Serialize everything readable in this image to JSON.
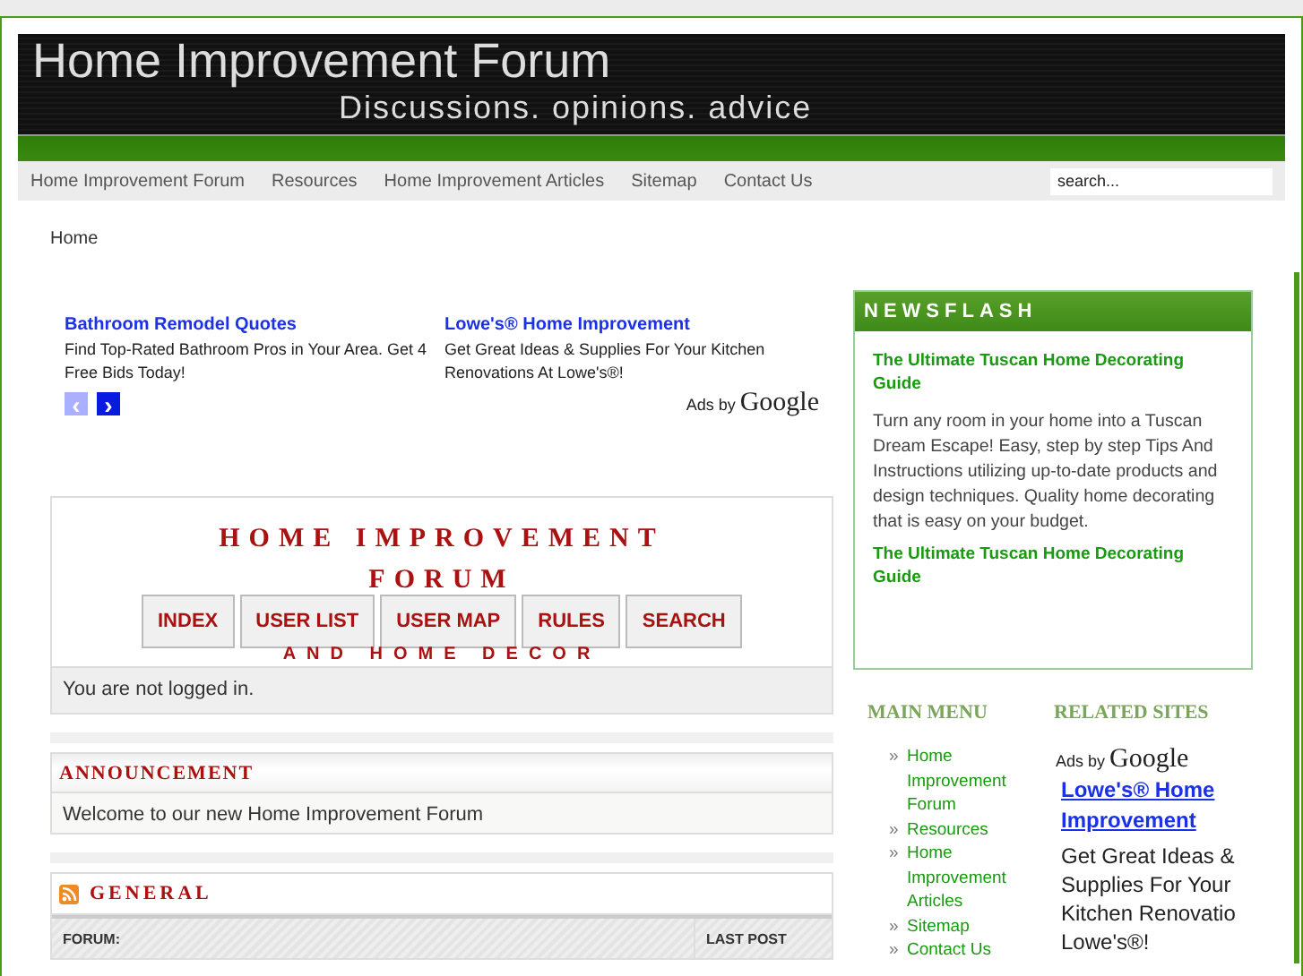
{
  "header": {
    "title": "Home Improvement Forum",
    "tagline": "Discussions. opinions. advice"
  },
  "nav": {
    "items": [
      {
        "label": "Home Improvement Forum"
      },
      {
        "label": "Resources"
      },
      {
        "label": "Home Improvement Articles"
      },
      {
        "label": "Sitemap"
      },
      {
        "label": "Contact Us"
      }
    ],
    "search": {
      "placeholder": "search..."
    }
  },
  "breadcrumb": "Home",
  "ads": {
    "items": [
      {
        "title": "Bathroom Remodel Quotes",
        "text": "Find Top-Rated Bathroom Pros in Your Area. Get 4 Free Bids Today!"
      },
      {
        "title": "Lowe's® Home Improvement",
        "text": "Get Great Ideas & Supplies For Your Kitchen Renovations At Lowe's®!"
      }
    ],
    "pager": [
      {
        "glyph": "‹",
        "disabled": true
      },
      {
        "glyph": "›",
        "disabled": false
      }
    ],
    "ads_by": "Ads by",
    "brand": "Google"
  },
  "forum": {
    "title_lines": [
      "HOME IMPROVEMENT",
      "FORUM"
    ],
    "subtitle": "AND HOME DECOR",
    "buttons": [
      "INDEX",
      "USER LIST",
      "USER MAP",
      "RULES",
      "SEARCH"
    ],
    "status": "You are not logged in."
  },
  "announcement": {
    "title": "ANNOUNCEMENT",
    "text": "Welcome to our new Home Improvement Forum"
  },
  "general": {
    "title": "GENERAL",
    "columns": [
      "FORUM:",
      "LAST POST"
    ]
  },
  "newsflash": {
    "title": "NEWSFLASH",
    "items": [
      {
        "kind": "link",
        "text": "The Ultimate Tuscan Home Decorating Guide"
      },
      {
        "kind": "text",
        "text": "Turn any room in your home into a Tuscan Dream Escape! Easy, step by step Tips And Instructions utilizing up-to-date products and design techniques. Quality home decorating that is easy on your budget."
      },
      {
        "kind": "link",
        "text": "The Ultimate Tuscan Home Decorating Guide"
      }
    ]
  },
  "main_menu": {
    "title": "MAIN MENU",
    "bullet": "»",
    "items": [
      {
        "label": "Home Improvement Forum"
      },
      {
        "label": "Resources"
      },
      {
        "label": "Home Improvement Articles"
      },
      {
        "label": "Sitemap"
      },
      {
        "label": "Contact Us"
      }
    ]
  },
  "related_sites": {
    "title": "RELATED SITES",
    "ads_by": "Ads by",
    "brand": "Google",
    "link": "Lowe's® Home Improvement",
    "lines": [
      "Get Great Ideas &",
      "Supplies For Your",
      "Kitchen Renovatio",
      "Lowe's®!"
    ]
  }
}
